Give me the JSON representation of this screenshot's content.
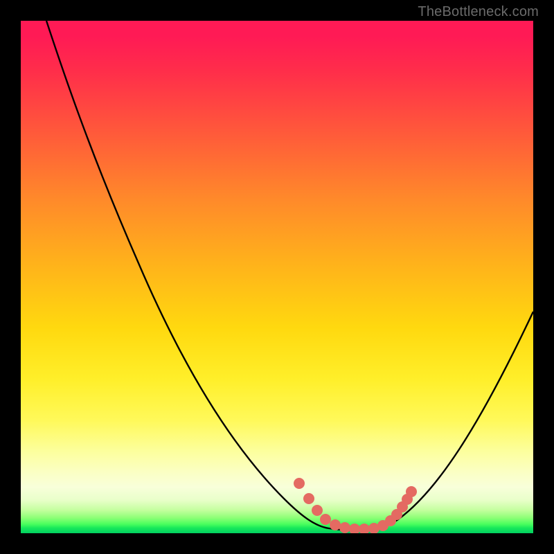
{
  "watermark": "TheBottleneck.com",
  "chart_data": {
    "type": "line",
    "title": "",
    "xlabel": "",
    "ylabel": "",
    "xlim": [
      0,
      100
    ],
    "ylim": [
      0,
      100
    ],
    "series": [
      {
        "name": "bottleneck-curve",
        "x": [
          5,
          10,
          15,
          20,
          25,
          30,
          35,
          40,
          45,
          50,
          55,
          58,
          60,
          62,
          64,
          66,
          68,
          70,
          72,
          75,
          80,
          85,
          90,
          95,
          100
        ],
        "y": [
          100,
          92,
          84,
          76,
          67,
          58,
          49,
          40,
          31,
          22,
          14,
          9,
          6,
          4,
          2.5,
          1.5,
          1,
          1,
          1.5,
          3,
          8,
          16,
          26,
          37,
          48
        ],
        "note": "y is approximate bottleneck % read from vertical position; 0 = bottom green band, 100 = top red"
      },
      {
        "name": "highlight-dots",
        "x": [
          56.5,
          58.5,
          60,
          62,
          64,
          66,
          68,
          70,
          71.5,
          73,
          74,
          74.8
        ],
        "y": [
          9.5,
          6.5,
          4.5,
          3,
          2,
          1.3,
          1,
          1,
          1.3,
          2.2,
          3.5,
          5
        ],
        "note": "coral dots sitting on and near the curve's minimum"
      }
    ],
    "colors": {
      "curve": "#000000",
      "dots": "#e46a62",
      "bg_top": "#ff1a55",
      "bg_bottom": "#00d060"
    }
  }
}
